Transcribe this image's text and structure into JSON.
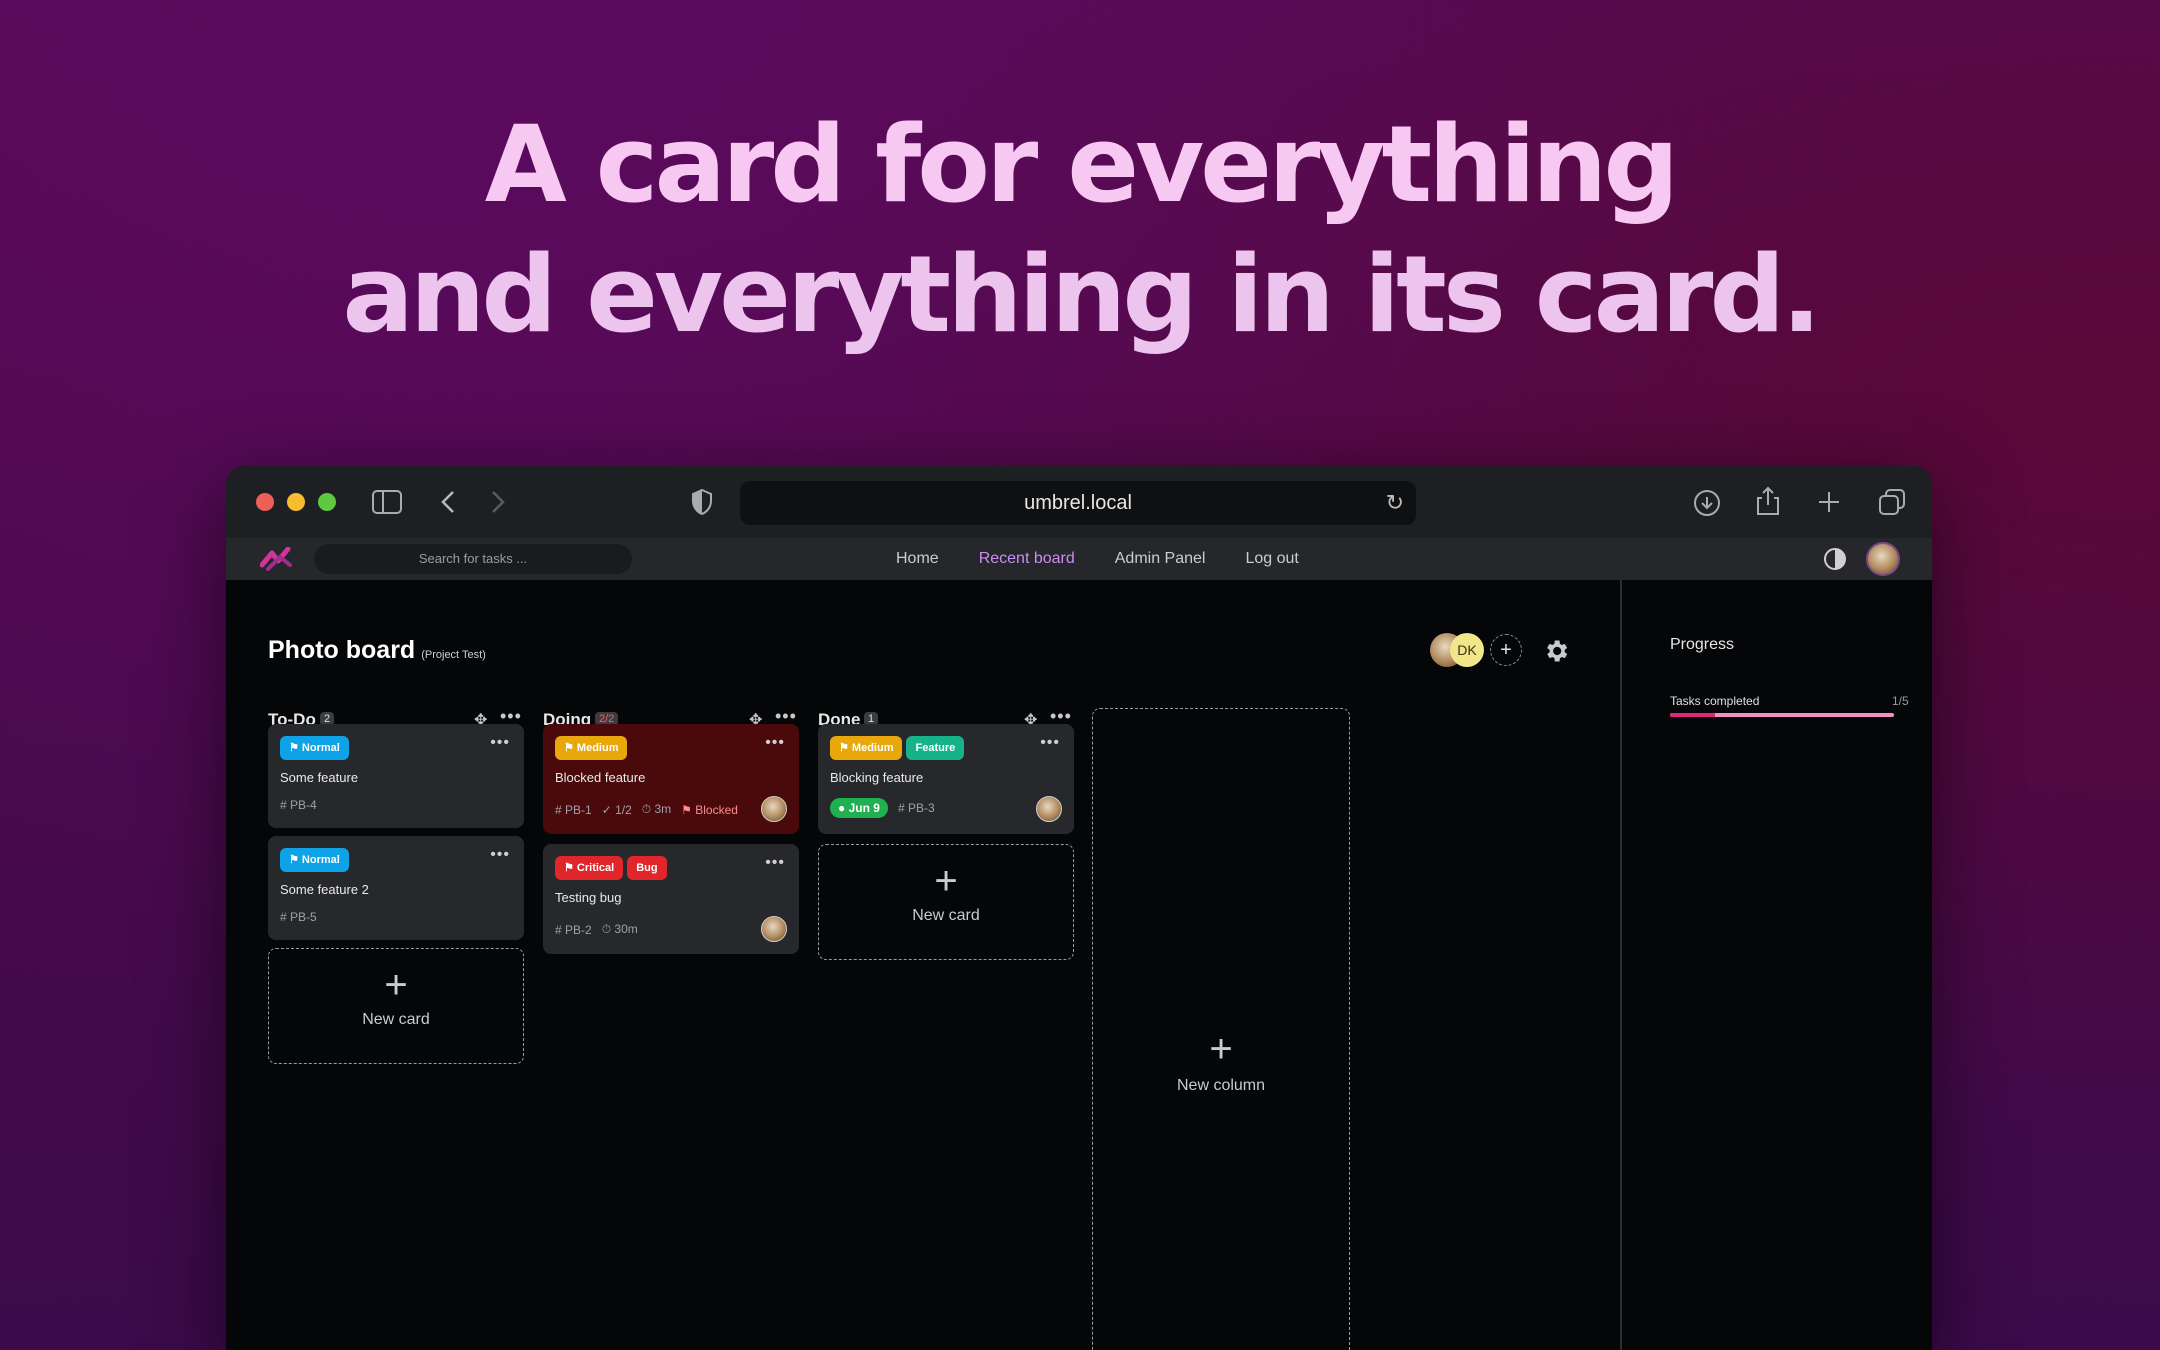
{
  "hero": {
    "line1": "A card for everything",
    "line2": "and everything in its card."
  },
  "browser": {
    "url": "umbrel.local"
  },
  "appbar": {
    "search_placeholder": "Search for tasks ...",
    "nav": [
      "Home",
      "Recent board",
      "Admin Panel",
      "Log out"
    ],
    "active_nav": "Recent board"
  },
  "board": {
    "title": "Photo board",
    "subtitle": "(Project Test)",
    "members": {
      "initials": "DK",
      "add": "+"
    },
    "columns": [
      {
        "title": "To-Do",
        "count": "2",
        "cards": [
          {
            "tags": [
              "Normal"
            ],
            "title": "Some feature",
            "id": "PB-4"
          },
          {
            "tags": [
              "Normal"
            ],
            "title": "Some feature 2",
            "id": "PB-5"
          }
        ],
        "new_card": "New card"
      },
      {
        "title": "Doing",
        "count": "2/2",
        "cards": [
          {
            "tags": [
              "Medium"
            ],
            "title": "Blocked feature",
            "id": "PB-1",
            "checklist": "1/2",
            "time": "3m",
            "status": "Blocked"
          },
          {
            "tags": [
              "Critical",
              "Bug"
            ],
            "title": "Testing bug",
            "id": "PB-2",
            "time": "30m"
          }
        ]
      },
      {
        "title": "Done",
        "count": "1",
        "cards": [
          {
            "tags": [
              "Medium",
              "Feature"
            ],
            "title": "Blocking feature",
            "date": "Jun 9",
            "id": "PB-3"
          }
        ],
        "new_card": "New card"
      }
    ],
    "new_column": "New column"
  },
  "progress": {
    "title": "Progress",
    "label": "Tasks completed",
    "value": "1/5",
    "fraction": 0.2
  },
  "colors": {
    "accent": "#c98df5",
    "normal": "#0ea3e6",
    "medium": "#e8a80c",
    "critical": "#e0262b",
    "feature": "#16b38a",
    "progress": "#e0267a"
  }
}
